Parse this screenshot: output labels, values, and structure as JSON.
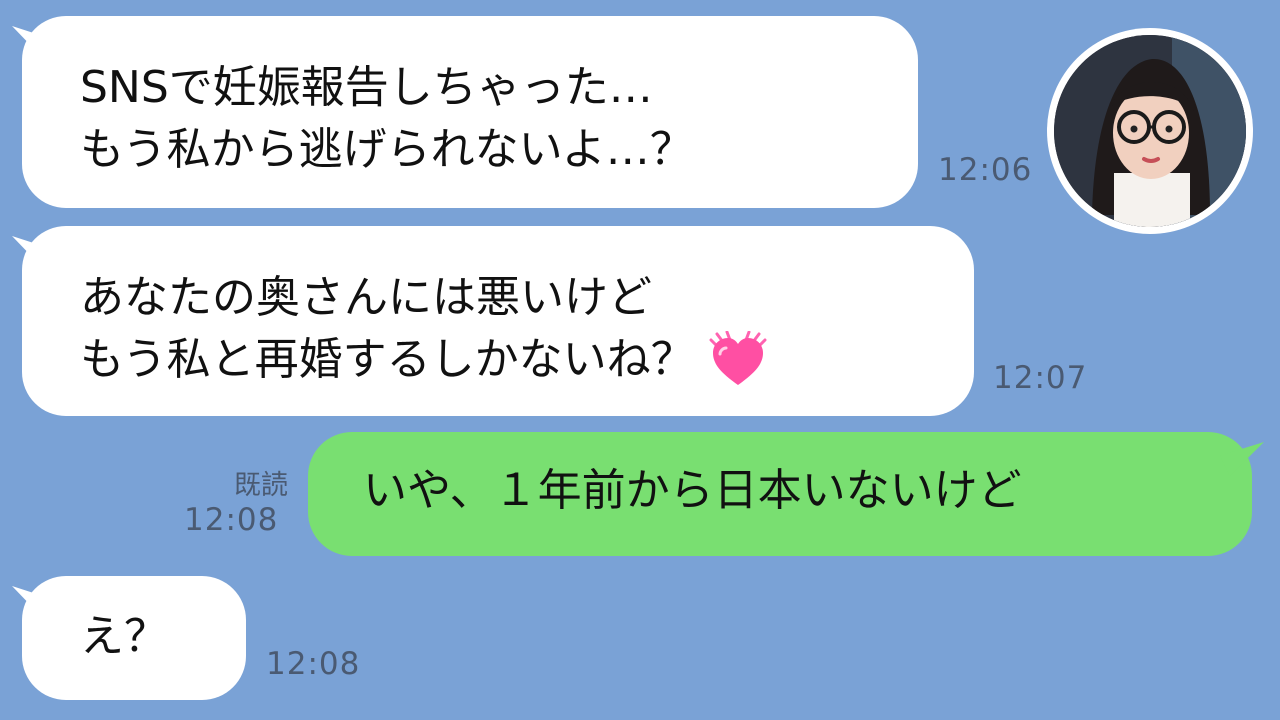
{
  "chat": {
    "messages": [
      {
        "sender": "other",
        "lines": [
          "SNSで妊娠報告しちゃった…",
          "もう私から逃げられないよ…？"
        ],
        "time": "12:06"
      },
      {
        "sender": "other",
        "lines": [
          "あなたの奥さんには悪いけど",
          "もう私と再婚するしかないね？"
        ],
        "emoji": "heart-icon",
        "time": "12:07"
      },
      {
        "sender": "self",
        "lines": [
          "いや、１年前から日本いないけど"
        ],
        "read_label": "既読",
        "time": "12:08"
      },
      {
        "sender": "other",
        "lines": [
          "え？"
        ],
        "time": "12:08"
      }
    ],
    "avatar": {
      "icon": "avatar-portrait"
    },
    "colors": {
      "background": "#7aa2d6",
      "incoming_bubble": "#ffffff",
      "outgoing_bubble": "#79df71",
      "heart": "#ff4fa3",
      "timestamp": "#4a5a72"
    }
  }
}
